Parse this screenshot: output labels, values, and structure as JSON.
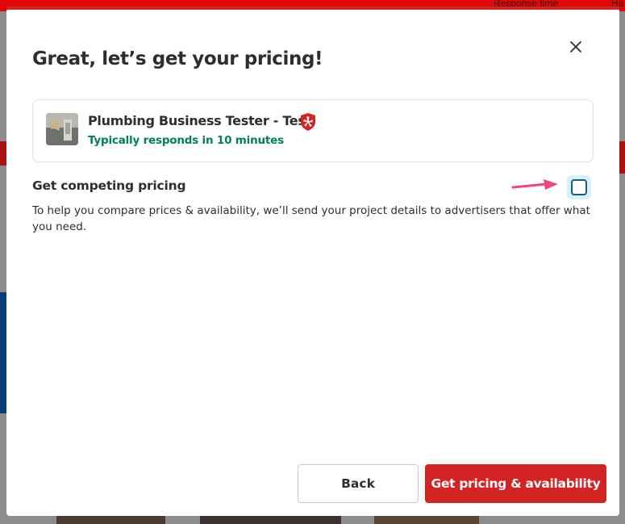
{
  "background": {
    "fragment_top_right": "Response time",
    "fragment_top_right_2": "Ha"
  },
  "modal": {
    "title": "Great, let’s get your pricing!",
    "business": {
      "name": "Plumbing Business Tester - Test",
      "response": "Typically responds in 10 minutes"
    },
    "competing": {
      "label": "Get competing pricing",
      "description": "To help you compare prices & availability, we’ll send your project details to advertisers that offer what you need.",
      "checked": false
    },
    "buttons": {
      "back": "Back",
      "primary": "Get pricing & availability"
    }
  },
  "colors": {
    "accent": "#d32323",
    "response_green": "#008055",
    "arrow_pink": "#f0467c",
    "checkbox_ring": "#d6f1fb"
  }
}
